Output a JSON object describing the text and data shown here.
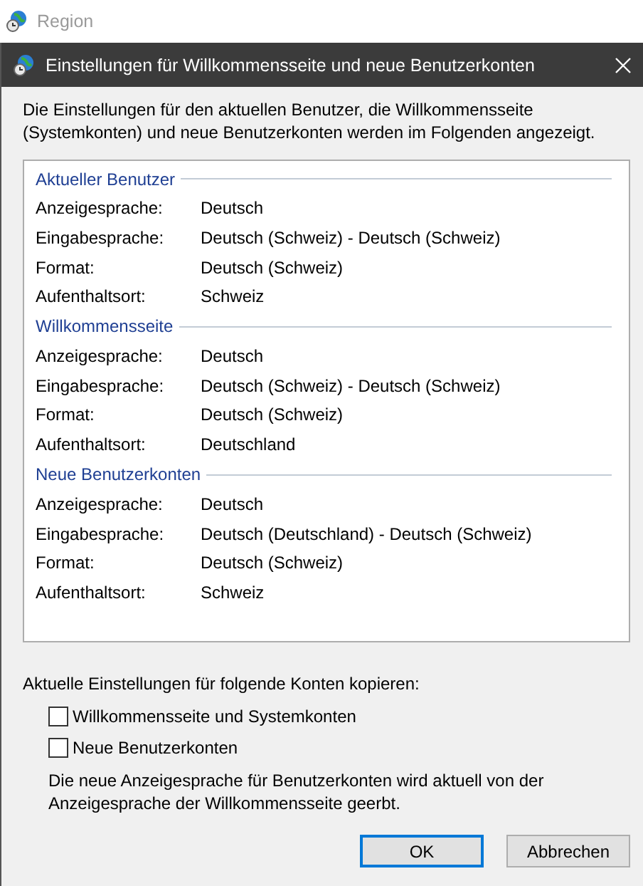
{
  "background_window": {
    "title": "Region"
  },
  "dialog": {
    "title": "Einstellungen für Willkommensseite und neue Benutzerkonten",
    "intro": "Die Einstellungen für den aktuellen Benutzer, die Willkommensseite (Systemkonten) und neue Benutzerkonten werden im Folgenden angezeigt.",
    "sections": [
      {
        "title": "Aktueller Benutzer",
        "rows": [
          {
            "label": "Anzeigesprache:",
            "value": "Deutsch"
          },
          {
            "label": "Eingabesprache:",
            "value": "Deutsch (Schweiz) - Deutsch (Schweiz)"
          },
          {
            "label": "Format:",
            "value": "Deutsch (Schweiz)"
          },
          {
            "label": "Aufenthaltsort:",
            "value": "Schweiz"
          }
        ]
      },
      {
        "title": "Willkommensseite",
        "rows": [
          {
            "label": "Anzeigesprache:",
            "value": "Deutsch"
          },
          {
            "label": "Eingabesprache:",
            "value": "Deutsch (Schweiz) - Deutsch (Schweiz)"
          },
          {
            "label": "Format:",
            "value": "Deutsch (Schweiz)"
          },
          {
            "label": "Aufenthaltsort:",
            "value": "Deutschland"
          }
        ]
      },
      {
        "title": "Neue Benutzerkonten",
        "rows": [
          {
            "label": "Anzeigesprache:",
            "value": "Deutsch"
          },
          {
            "label": "Eingabesprache:",
            "value": "Deutsch (Deutschland) - Deutsch (Schweiz)"
          },
          {
            "label": "Format:",
            "value": "Deutsch (Schweiz)"
          },
          {
            "label": "Aufenthaltsort:",
            "value": "Schweiz"
          }
        ]
      }
    ],
    "copy_label": "Aktuelle Einstellungen für folgende Konten kopieren:",
    "checkboxes": [
      {
        "label": "Willkommensseite und Systemkonten",
        "checked": false
      },
      {
        "label": "Neue Benutzerkonten",
        "checked": false
      }
    ],
    "note": "Die neue Anzeigesprache für Benutzerkonten wird aktuell von der Anzeigesprache der Willkommensseite geerbt.",
    "buttons": [
      {
        "label": "OK",
        "default": true
      },
      {
        "label": "Abbrechen",
        "default": false
      }
    ]
  }
}
